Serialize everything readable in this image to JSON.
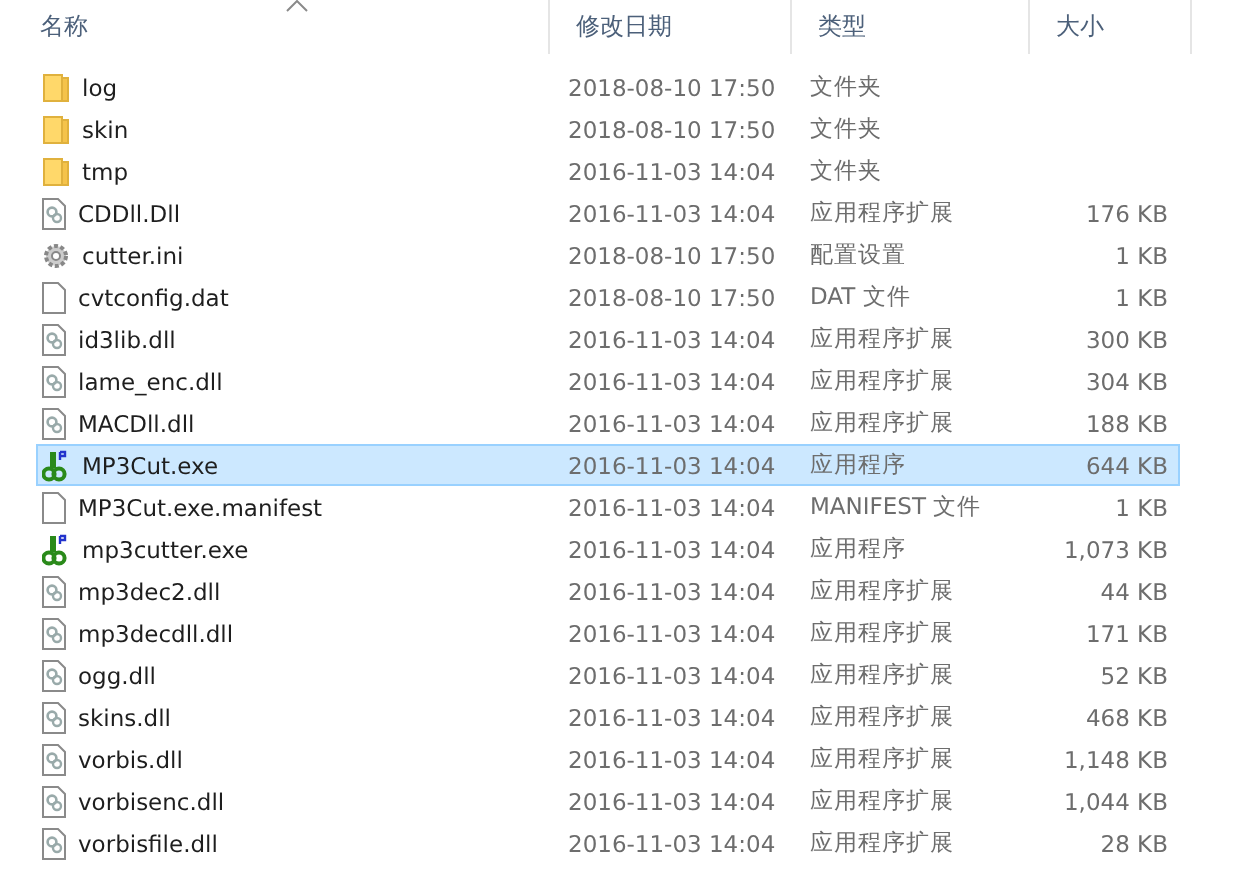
{
  "columns": [
    {
      "label": "名称",
      "sorted": true
    },
    {
      "label": "修改日期",
      "sorted": false
    },
    {
      "label": "类型",
      "sorted": false
    },
    {
      "label": "大小",
      "sorted": false
    }
  ],
  "files": [
    {
      "name": "log",
      "date": "2018-08-10 17:50",
      "type": "文件夹",
      "kind": "folder",
      "selected": false
    },
    {
      "name": "skin",
      "date": "2018-08-10 17:50",
      "type": "文件夹",
      "kind": "folder",
      "selected": false
    },
    {
      "name": "tmp",
      "date": "2016-11-03 14:04",
      "type": "文件夹",
      "kind": "folder",
      "selected": false
    },
    {
      "name": "CDDll.Dll",
      "date": "2016-11-03 14:04",
      "type": "应用程序扩展",
      "size": "176 KB",
      "kind": "dll",
      "selected": false
    },
    {
      "name": "cutter.ini",
      "date": "2018-08-10 17:50",
      "type": "配置设置",
      "size": "1 KB",
      "kind": "ini",
      "selected": false
    },
    {
      "name": "cvtconfig.dat",
      "date": "2018-08-10 17:50",
      "type": "DAT 文件",
      "size": "1 KB",
      "kind": "file",
      "selected": false
    },
    {
      "name": "id3lib.dll",
      "date": "2016-11-03 14:04",
      "type": "应用程序扩展",
      "size": "300 KB",
      "kind": "dll",
      "selected": false
    },
    {
      "name": "lame_enc.dll",
      "date": "2016-11-03 14:04",
      "type": "应用程序扩展",
      "size": "304 KB",
      "kind": "dll",
      "selected": false
    },
    {
      "name": "MACDll.dll",
      "date": "2016-11-03 14:04",
      "type": "应用程序扩展",
      "size": "188 KB",
      "kind": "dll",
      "selected": false
    },
    {
      "name": "MP3Cut.exe",
      "date": "2016-11-03 14:04",
      "type": "应用程序",
      "size": "644 KB",
      "kind": "exe",
      "selected": true
    },
    {
      "name": "MP3Cut.exe.manifest",
      "date": "2016-11-03 14:04",
      "type": "MANIFEST 文件",
      "size": "1 KB",
      "kind": "file",
      "selected": false
    },
    {
      "name": "mp3cutter.exe",
      "date": "2016-11-03 14:04",
      "type": "应用程序",
      "size": "1,073 KB",
      "kind": "exe",
      "selected": false
    },
    {
      "name": "mp3dec2.dll",
      "date": "2016-11-03 14:04",
      "type": "应用程序扩展",
      "size": "44 KB",
      "kind": "dll",
      "selected": false
    },
    {
      "name": "mp3decdll.dll",
      "date": "2016-11-03 14:04",
      "type": "应用程序扩展",
      "size": "171 KB",
      "kind": "dll",
      "selected": false
    },
    {
      "name": "ogg.dll",
      "date": "2016-11-03 14:04",
      "type": "应用程序扩展",
      "size": "52 KB",
      "kind": "dll",
      "selected": false
    },
    {
      "name": "skins.dll",
      "date": "2016-11-03 14:04",
      "type": "应用程序扩展",
      "size": "468 KB",
      "kind": "dll",
      "selected": false
    },
    {
      "name": "vorbis.dll",
      "date": "2016-11-03 14:04",
      "type": "应用程序扩展",
      "size": "1,148 KB",
      "kind": "dll",
      "selected": false
    },
    {
      "name": "vorbisenc.dll",
      "date": "2016-11-03 14:04",
      "type": "应用程序扩展",
      "size": "1,044 KB",
      "kind": "dll",
      "selected": false
    },
    {
      "name": "vorbisfile.dll",
      "date": "2016-11-03 14:04",
      "type": "应用程序扩展",
      "size": "28 KB",
      "kind": "dll",
      "selected": false
    }
  ]
}
